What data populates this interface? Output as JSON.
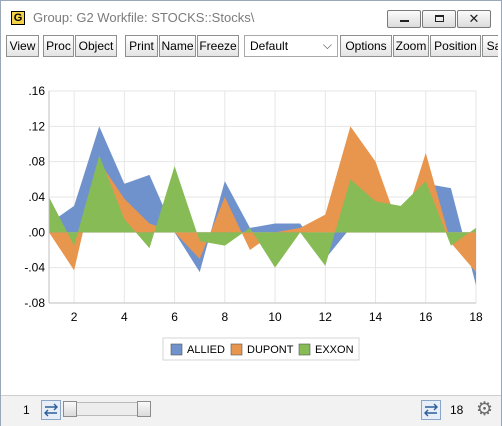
{
  "window": {
    "title": "Group: G2   Workfile: STOCKS::Stocks\\",
    "app_icon_letter": "G",
    "close_glyph": "✕"
  },
  "toolbar": {
    "view": "View",
    "proc": "Proc",
    "object": "Object",
    "print": "Print",
    "name": "Name",
    "freeze": "Freeze",
    "dropdown_value": "Default",
    "options": "Options",
    "zoom": "Zoom",
    "position": "Position",
    "sample": "Sa"
  },
  "status": {
    "left_value": "1",
    "right_value": "18"
  },
  "icons": {
    "app": "graph-app-icon",
    "minimize": "minimize-icon",
    "maximize": "maximize-icon",
    "close": "close-icon",
    "dropdown": "chevron-down-icon",
    "swap": "swap-arrows-icon",
    "settings": "gear-icon"
  },
  "colors": {
    "allied": "#7092cc",
    "dupont": "#e8954e",
    "exxon": "#87bb55"
  },
  "chart_data": {
    "type": "area",
    "x": [
      1,
      2,
      3,
      4,
      5,
      6,
      7,
      8,
      9,
      10,
      11,
      12,
      13,
      14,
      15,
      16,
      17,
      18
    ],
    "x_ticks": [
      "2",
      "4",
      "6",
      "8",
      "10",
      "12",
      "14",
      "16",
      "18"
    ],
    "y_ticks": [
      ".16",
      ".12",
      ".08",
      ".04",
      ".00",
      "-.04",
      "-.08"
    ],
    "ylim": [
      -0.08,
      0.16
    ],
    "grid": true,
    "legend_position": "bottom-center",
    "series": [
      {
        "name": "ALLIED",
        "values": [
          0.01,
          0.03,
          0.12,
          0.055,
          0.065,
          0.0,
          -0.045,
          0.058,
          0.005,
          0.01,
          0.01,
          -0.03,
          0.005,
          0.028,
          0.0,
          0.055,
          0.05,
          -0.06
        ]
      },
      {
        "name": "DUPONT",
        "values": [
          0.0,
          -0.043,
          0.08,
          0.038,
          0.01,
          0.0,
          -0.03,
          0.04,
          -0.02,
          0.0,
          0.005,
          0.02,
          0.12,
          0.08,
          0.0,
          0.09,
          -0.012,
          -0.045
        ]
      },
      {
        "name": "EXXON",
        "values": [
          0.04,
          -0.015,
          0.087,
          0.015,
          -0.018,
          0.075,
          -0.01,
          -0.015,
          0.005,
          -0.04,
          0.0,
          -0.038,
          0.06,
          0.035,
          0.03,
          0.058,
          -0.015,
          0.005
        ]
      }
    ]
  }
}
